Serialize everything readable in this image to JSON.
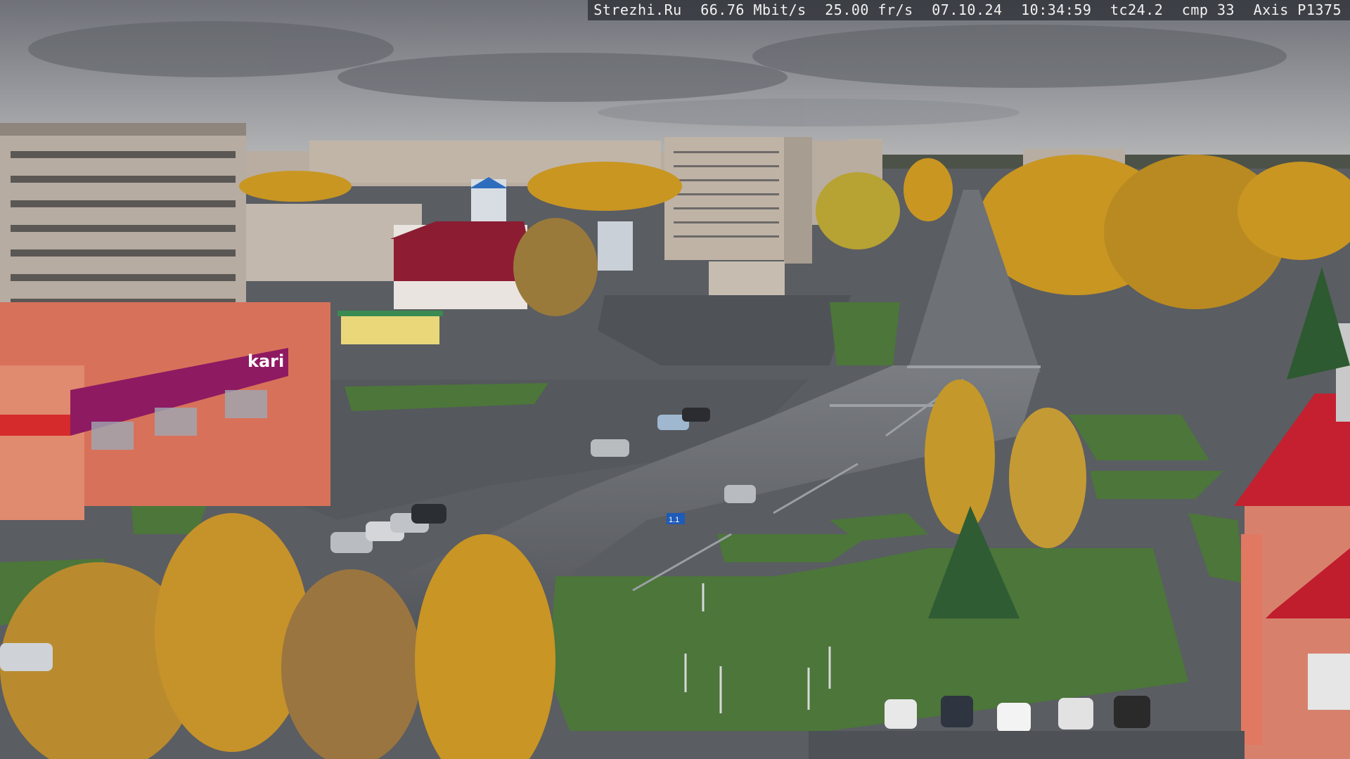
{
  "overlay": {
    "site": "Strezhi.Ru",
    "bitrate": "66.76 Mbit/s",
    "framerate": "25.00 fr/s",
    "date": "07.10.24",
    "time": "10:34:59",
    "tc": "tc24.2",
    "cmp": "cmp 33",
    "camera": "Axis P1375"
  },
  "signs": {
    "store_brand": "kari",
    "road_sign": "1.1"
  },
  "colors": {
    "sky": "#8d9096",
    "asphalt": "#5b5e63",
    "grass": "#4f7a3a",
    "foliage_yellow": "#c8941e",
    "store_magenta": "#9a1d6a",
    "roof_red": "#b51c2e"
  }
}
